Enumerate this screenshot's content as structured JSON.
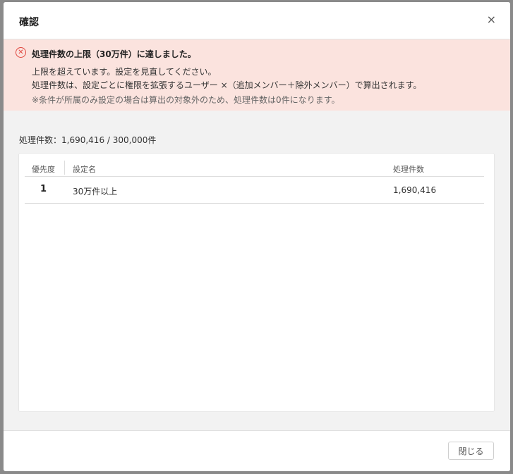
{
  "dialog": {
    "title": "確認",
    "close_icon": "×"
  },
  "alert": {
    "icon": "error-circle-icon",
    "icon_glyph": "✕",
    "title": "処理件数の上限（30万件）に達しました。",
    "line1": "上限を超えています。設定を見直してください。",
    "line2": "処理件数は、設定ごとに権限を拡張するユーザー ×（追加メンバー＋除外メンバー）で算出されます。",
    "note": "※条件が所属のみ設定の場合は算出の対象外のため、処理件数は0件になります。"
  },
  "summary": "処理件数：1,690,416 / 300,000件",
  "table": {
    "headers": {
      "priority": "優先度",
      "name": "設定名",
      "count": "処理件数"
    },
    "rows": [
      {
        "priority": "1",
        "name": "30万件以上",
        "count": "1,690,416"
      }
    ]
  },
  "footer": {
    "close_label": "閉じる"
  },
  "colors": {
    "alert_bg": "#fbe3de",
    "alert_icon": "#e0463d",
    "dialog_bg": "#f2f2f2",
    "overlay": "#8a8a8a"
  }
}
